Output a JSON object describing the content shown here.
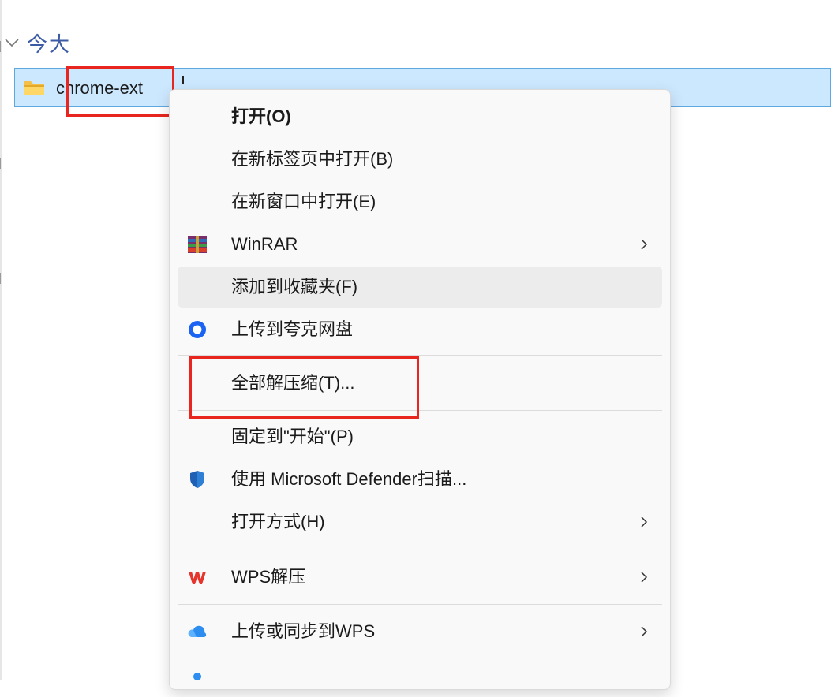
{
  "explorer": {
    "group_header": "今大",
    "file": {
      "name": "chrome-ext"
    }
  },
  "context_menu": {
    "items": [
      {
        "label": "打开(O)",
        "icon": null,
        "submenu": false
      },
      {
        "label": "在新标签页中打开(B)",
        "icon": null,
        "submenu": false
      },
      {
        "label": "在新窗口中打开(E)",
        "icon": null,
        "submenu": false
      },
      {
        "label": "WinRAR",
        "icon": "winrar-icon",
        "submenu": true
      },
      {
        "label": "添加到收藏夹(F)",
        "icon": null,
        "submenu": false
      },
      {
        "label": "上传到夸克网盘",
        "icon": "quark-drive-icon",
        "submenu": false
      },
      {
        "label": "全部解压缩(T)...",
        "icon": null,
        "submenu": false
      },
      {
        "label": "固定到\"开始\"(P)",
        "icon": null,
        "submenu": false
      },
      {
        "label": "使用 Microsoft Defender扫描...",
        "icon": "defender-shield-icon",
        "submenu": false
      },
      {
        "label": "打开方式(H)",
        "icon": null,
        "submenu": true
      },
      {
        "label": "WPS解压",
        "icon": "wps-icon",
        "submenu": true
      },
      {
        "label": "上传或同步到WPS",
        "icon": "wps-cloud-icon",
        "submenu": true
      }
    ]
  },
  "colors": {
    "selection": "#cce8ff",
    "annotation_red": "#e8261f",
    "group_header": "#3b5ba5",
    "menu_bg": "#f9f9f9",
    "hover": "#ececec"
  }
}
